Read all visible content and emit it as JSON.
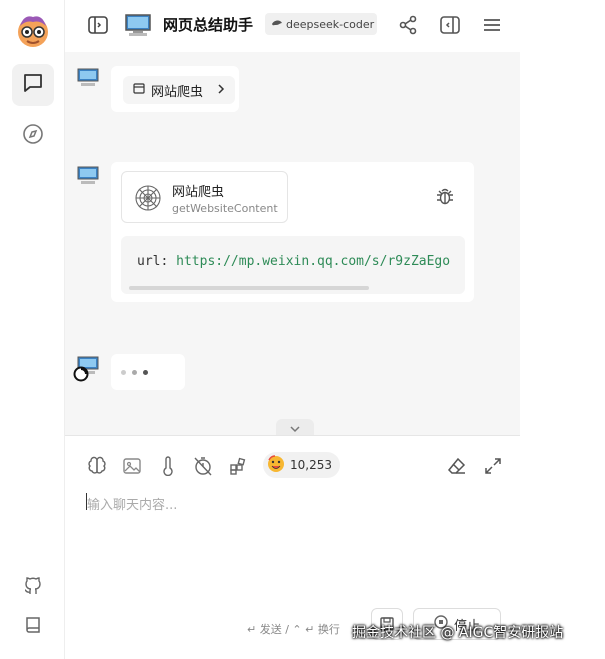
{
  "header": {
    "title": "网页总结助手",
    "model": "deepseek-coder"
  },
  "messages": {
    "plugin_tag": "网站爬虫",
    "tool": {
      "name": "网站爬虫",
      "function": "getWebsiteContent"
    },
    "code": {
      "key": "url:",
      "value": "https://mp.weixin.qq.com/s/r9zZaEgo"
    }
  },
  "composer": {
    "token_count": "10,253",
    "placeholder": "输入聊天内容...",
    "hint": "↵ 发送 / ⌃ ↵ 换行",
    "stop_label": "停止"
  },
  "watermark": "掘金技术社区 @ AIGC智安研报站",
  "icons": {
    "logo": "cartoon-face-icon",
    "rail": [
      "chat-icon",
      "compass-icon",
      "github-icon",
      "book-icon"
    ],
    "header": [
      "sidebar-toggle-icon",
      "share-icon",
      "panel-icon",
      "menu-icon"
    ],
    "composer": [
      "brain-icon",
      "image-icon",
      "thermometer-icon",
      "timer-off-icon",
      "plugin-grid-icon",
      "eraser-icon",
      "expand-icon"
    ]
  },
  "colors": {
    "accent_green": "#2e8b57",
    "main_bg": "#f6f6f6"
  }
}
